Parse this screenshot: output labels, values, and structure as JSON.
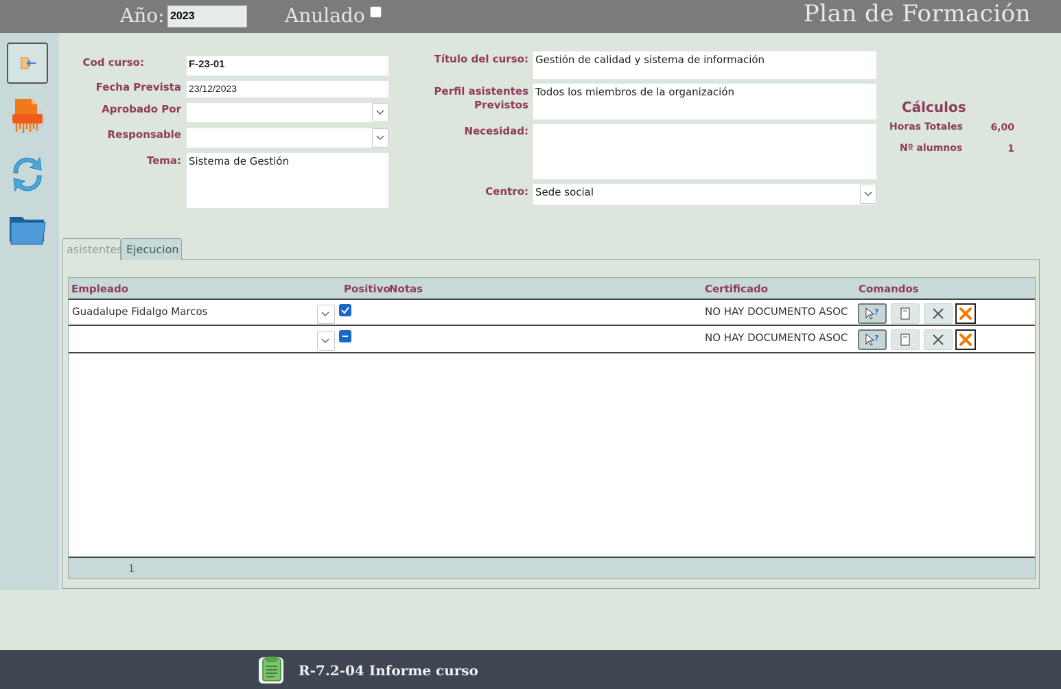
{
  "header": {
    "year_label": "Año:",
    "year_value": "2023",
    "anulado_label": "Anulado",
    "anulado_checked": false,
    "title": "Plan de Formación"
  },
  "sidebar": {
    "items": [
      {
        "icon": "exit-icon"
      },
      {
        "icon": "pdf-report-icon"
      },
      {
        "icon": "refresh-icon"
      },
      {
        "icon": "folder-icon"
      }
    ]
  },
  "form": {
    "cod_curso": {
      "label": "Cod curso:",
      "value": "F-23-01"
    },
    "fecha_prevista": {
      "label": "Fecha Prevista",
      "value": "23/12/2023"
    },
    "aprobado_por": {
      "label": "Aprobado Por",
      "value": ""
    },
    "responsable": {
      "label": "Responsable",
      "value": ""
    },
    "tema": {
      "label": "Tema:",
      "value": "Sistema de Gestión"
    },
    "titulo": {
      "label": "Título del curso:",
      "value": "Gestión de calidad y sistema de información"
    },
    "perfil": {
      "label_line1": "Perfil asistentes",
      "label_line2": "Previstos",
      "value": "Todos los miembros de la organización"
    },
    "necesidad": {
      "label": "Necesidad:",
      "value": ""
    },
    "centro": {
      "label": "Centro:",
      "value": "Sede social"
    }
  },
  "calculos": {
    "title": "Cálculos",
    "horas_label": "Horas Totales",
    "horas_value": "6,00",
    "alumnos_label": "Nº alumnos",
    "alumnos_value": "1"
  },
  "tabs": [
    {
      "label": "asistentes",
      "active": true
    },
    {
      "label": "Ejecucion",
      "active": false
    }
  ],
  "grid": {
    "columns": {
      "empleado": "Empleado",
      "positivo": "Positivo",
      "notas": "Notas",
      "certificado": "Certificado",
      "comandos": "Comandos"
    },
    "rows": [
      {
        "empleado": "Guadalupe Fidalgo Marcos",
        "positivo": "checked",
        "certificado": "NO HAY DOCUMENTO ASOC"
      },
      {
        "empleado": "",
        "positivo": "indeterminate",
        "certificado": "NO HAY DOCUMENTO ASOC"
      }
    ],
    "footer_count": "1"
  },
  "footer": {
    "report_label": "R-7.2-04 Informe curso"
  },
  "colors": {
    "label": "#8f3b5c",
    "topbar": "#7b7b7b",
    "bottombar": "#404552",
    "checkbox": "#1a66c9",
    "delete_x": "#f07a00"
  }
}
